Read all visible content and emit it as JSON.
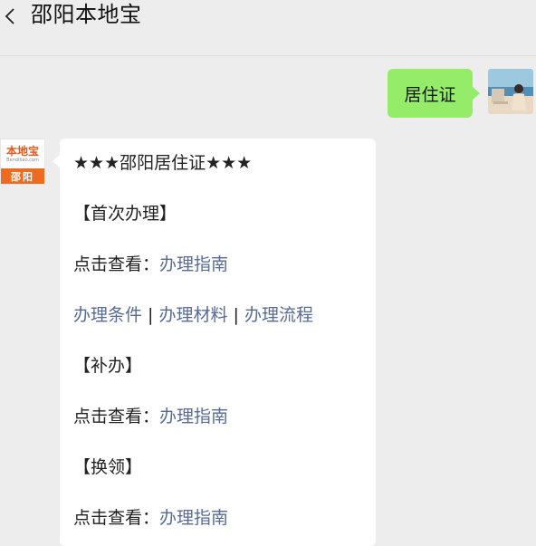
{
  "header": {
    "title": "邵阳本地宝"
  },
  "outgoing": {
    "text": "居住证"
  },
  "bot": {
    "logo_text": "本地宝",
    "logo_sub": "Bendibao.com",
    "logo_city": "邵阳"
  },
  "message": {
    "heading": "★★★邵阳居住证★★★",
    "section1": "【首次办理】",
    "click_prefix_1": "点击查看：",
    "guide_link_1": "办理指南",
    "link_conditions": "办理条件",
    "link_materials": "办理材料",
    "link_process": "办理流程",
    "separator": " | ",
    "section2": "【补办】",
    "click_prefix_2": "点击查看：",
    "guide_link_2": "办理指南",
    "section3": "【换领】",
    "click_prefix_3": "点击查看：",
    "guide_link_3": "办理指南"
  },
  "colors": {
    "outgoing_bubble": "#95ec69",
    "link": "#576b95",
    "logo_orange": "#ee6a1f"
  }
}
